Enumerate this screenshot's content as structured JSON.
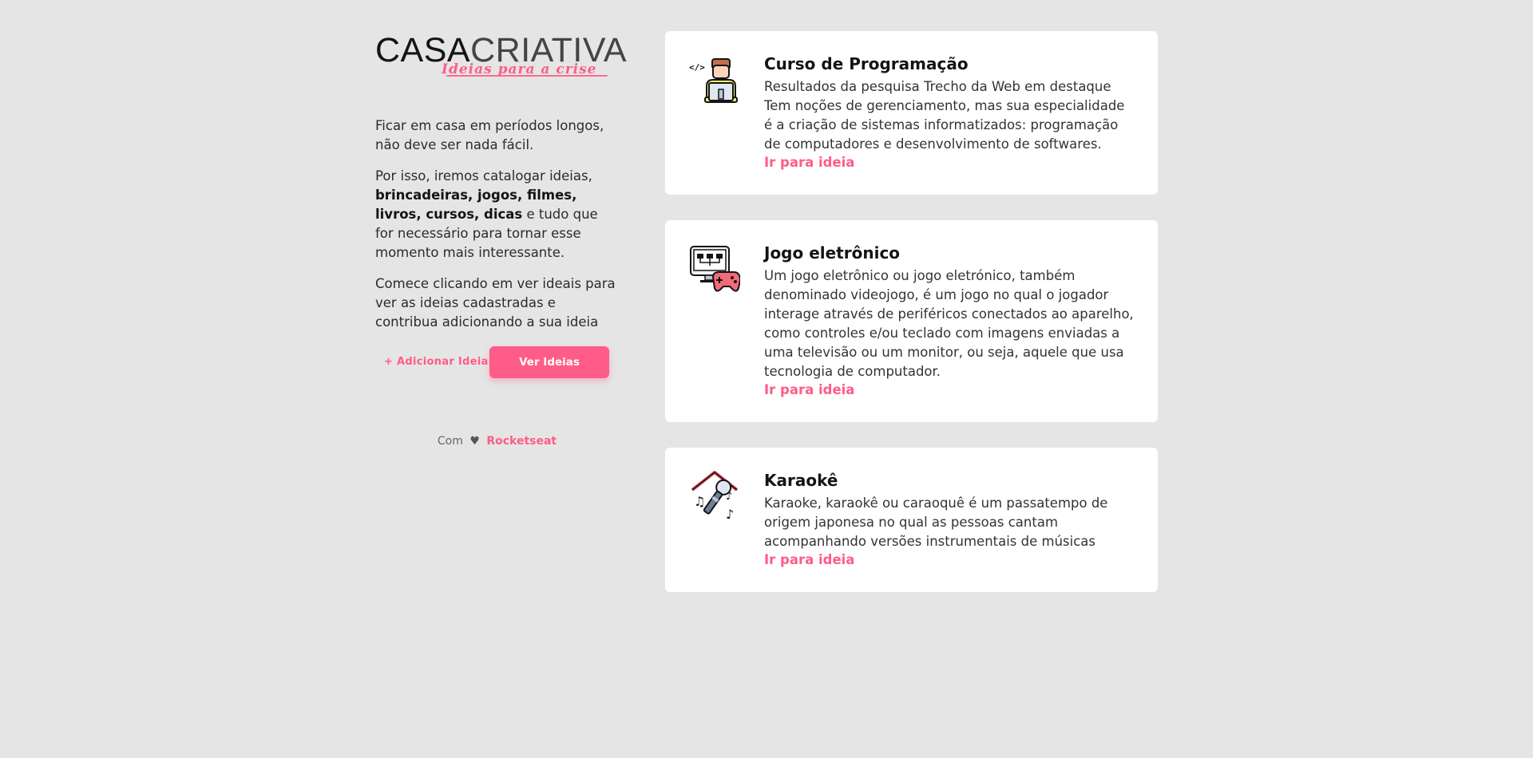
{
  "logo": {
    "part1": "CASA",
    "part2": "CRIATIVA",
    "tagline": "Ideias para a crise"
  },
  "intro": {
    "p1": "Ficar em casa em períodos longos, não deve ser nada fácil.",
    "p2_before": "Por isso, iremos catalogar ideias, ",
    "p2_bold": "brincadeiras, jogos, filmes, livros, cursos, dicas",
    "p2_after": " e tudo que for necessário para tornar esse momento mais interessante.",
    "p3": "Comece clicando em ver ideais para ver as ideias cadastradas e contribua adicionando a sua ideia"
  },
  "actions": {
    "add_label": "+ Adicionar Ideia",
    "view_label": "Ver Ideias"
  },
  "footer": {
    "prefix": "Com",
    "heart": "♥",
    "brand": "Rocketseat"
  },
  "cards": [
    {
      "icon": "programmer-icon",
      "title": "Curso de Programação",
      "description": "Resultados da pesquisa Trecho da Web em destaque Tem noções de gerenciamento, mas sua especialidade é a criação de sistemas informatizados: programação de computadores e desenvolvimento de softwares.",
      "link": "Ir para ideia"
    },
    {
      "icon": "videogame-icon",
      "title": "Jogo eletrônico",
      "description": "Um jogo eletrônico ou jogo eletrónico, também denominado videojogo, é um jogo no qual o jogador interage através de periféricos conectados ao aparelho, como controles e/ou teclado com imagens enviadas a uma televisão ou um monitor, ou seja, aquele que usa tecnologia de computador.",
      "link": "Ir para ideia"
    },
    {
      "icon": "karaoke-icon",
      "title": "Karaokê",
      "description": "Karaoke, karaokê ou caraoquê é um passatempo de origem japonesa no qual as pessoas cantam acompanhando versões instrumentais de músicas",
      "link": "Ir para ideia"
    }
  ],
  "colors": {
    "accent": "#ff5c87",
    "background": "#e5e5e5",
    "card": "#ffffff",
    "text": "#141414"
  }
}
